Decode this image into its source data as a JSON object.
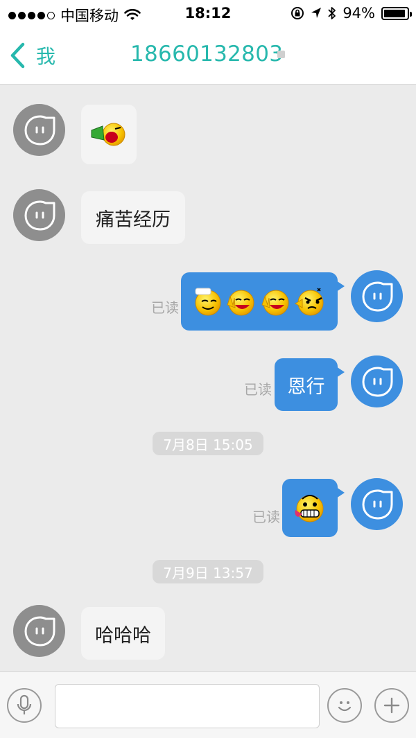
{
  "status_bar": {
    "carrier": "中国移动",
    "time": "18:12",
    "battery_text": "94%",
    "battery_level": 0.94
  },
  "nav": {
    "back_label": "我",
    "title": "18660132803"
  },
  "messages": [
    {
      "id": "m1",
      "side": "in",
      "type": "emoji",
      "emojis": [
        "horn-shouting-emoji"
      ]
    },
    {
      "id": "m2",
      "side": "in",
      "type": "text",
      "text": "痛苦经历"
    },
    {
      "id": "m3",
      "side": "out",
      "type": "emoji",
      "status": "已读",
      "emojis": [
        "shy-emoji",
        "victory-emoji",
        "victory-emoji",
        "angry-emoji"
      ]
    },
    {
      "id": "m4",
      "side": "out",
      "type": "text",
      "text": "恩行",
      "status": "已读"
    },
    {
      "id": "ts1",
      "type": "timestamp",
      "text": "7月8日 15:05"
    },
    {
      "id": "m5",
      "side": "out",
      "type": "emoji",
      "status": "已读",
      "emojis": [
        "tongue-out-emoji"
      ]
    },
    {
      "id": "ts2",
      "type": "timestamp",
      "text": "7月9日 13:57"
    },
    {
      "id": "m6",
      "side": "in",
      "type": "text",
      "text": "哈哈哈"
    }
  ],
  "input": {
    "placeholder": "",
    "value": ""
  },
  "colors": {
    "accent": "#27b8ad",
    "outgoing_bubble": "#3d8fe0",
    "incoming_bubble": "#f4f4f4",
    "chat_background": "#ebebeb"
  }
}
